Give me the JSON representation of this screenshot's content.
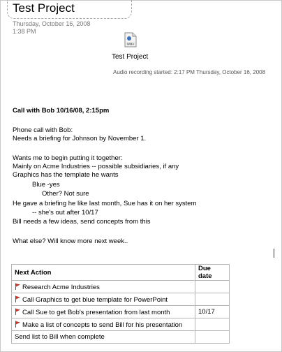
{
  "page": {
    "title": "Test Project",
    "date": "Thursday, October 16, 2008",
    "time": "1:38 PM"
  },
  "audio": {
    "icon": "wma-file-icon",
    "icon_label": "WMA",
    "name": "Test Project",
    "started": "Audio recording started: 2:17 PM Thursday, October 16, 2008"
  },
  "notes": {
    "heading": "Call with Bob 10/16/08,  2:15pm",
    "lines": [
      "Phone call with Bob:",
      "Needs a briefing for Johnson by November 1.",
      "Wants me to begin putting it together:",
      "Mainly on Acme Industries -- possible subsidiaries, if any",
      "Graphics has the template he wants",
      "Blue -yes",
      "Other? Not sure",
      "He gave a briefing he like last month, Sue has it on her system",
      "-- she's out after 10/17",
      "Bill needs a few ideas, send concepts from this",
      "What else?  Will  know more next week.."
    ]
  },
  "table": {
    "headers": [
      "Next Action",
      "Due date"
    ],
    "rows": [
      {
        "action": "Research Acme Industries",
        "due": "",
        "flag": true
      },
      {
        "action": "Call Graphics to get blue template for PowerPoint",
        "due": "",
        "flag": true
      },
      {
        "action": "Call Sue to get Bob's presentation from last month",
        "due": "10/17",
        "flag": true
      },
      {
        "action": "Make a list of concepts to send Bill for his presentation",
        "due": "",
        "flag": true
      },
      {
        "action": "Send list to Bill  when complete",
        "due": "",
        "flag": false
      }
    ],
    "flag_color": "#c0392b"
  }
}
